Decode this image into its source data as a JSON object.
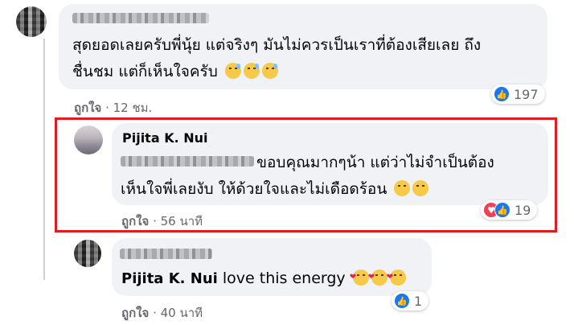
{
  "comments": [
    {
      "text_line1": "สุดยอดเลยครับพี่นุ้ย แต่จริงๆ มันไม่ควรเป็นเราที่ต้องเสียเลย ถึง",
      "text_line2": "ชื่นชม แต่ก็เห็นใจครับ",
      "like_label": "ถูกใจ",
      "time": "12 ชม.",
      "reaction_count": "197",
      "emojis": [
        "downcast-sweat-face",
        "downcast-sweat-face",
        "downcast-sweat-face"
      ]
    },
    {
      "author": "Pijita K. Nui",
      "text_line1": "ขอบคุณมากๆน้า แต่ว่าไม่จำเป็นต้อง",
      "text_line2": "เห็นใจพี่เลยงับ ให้ด้วยใจและไม่เดือดร้อน",
      "like_label": "ถูกใจ",
      "time": "56 นาที",
      "reaction_count": "19",
      "emojis": [
        "smiling-face",
        "smiling-face"
      ]
    },
    {
      "tagged": "Pijita K. Nui",
      "text": "love this energy",
      "like_label": "ถูกใจ",
      "time": "40 นาที",
      "reaction_count": "1",
      "emojis": [
        "smiling-face-with-hearts",
        "face-blowing-kiss",
        "face-blowing-kiss"
      ]
    }
  ],
  "separator": "·",
  "colors": {
    "highlight_border": "#e11b22",
    "like_blue": "#1877f2",
    "love_red": "#f33e58",
    "bubble_bg": "#f0f2f5"
  }
}
